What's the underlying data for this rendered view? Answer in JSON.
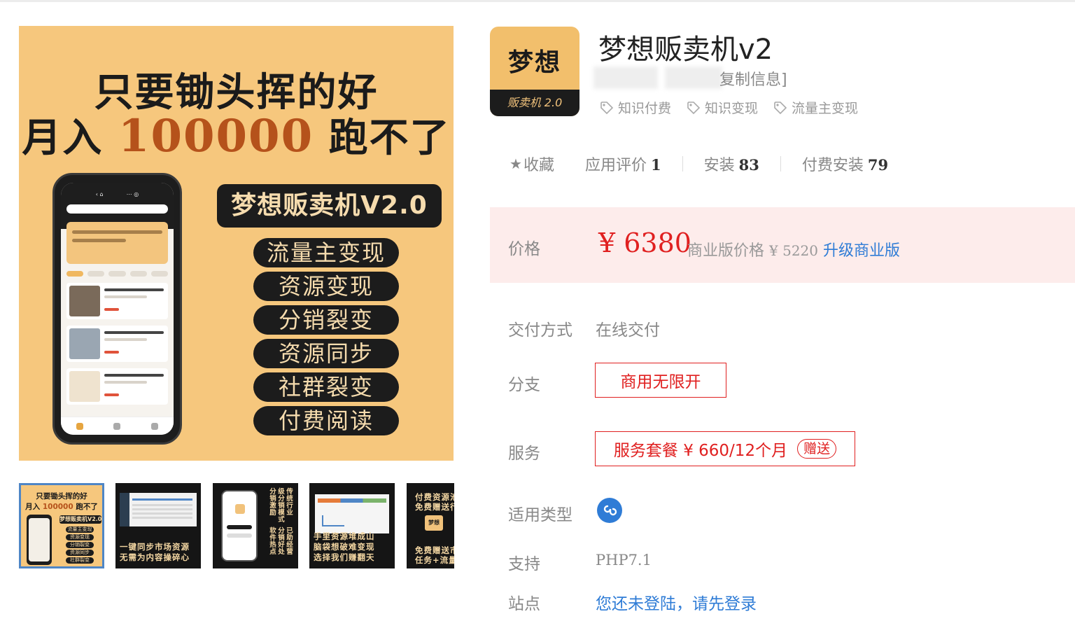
{
  "hero": {
    "line1": "只要锄头挥的好",
    "line2_pre": "月入",
    "line2_num": "100000",
    "line2_post": "跑不了",
    "product_name": "梦想贩卖机V2.0",
    "features": [
      "流量主变现",
      "资源变现",
      "分销裂变",
      "资源同步",
      "社群裂变",
      "付费阅读"
    ]
  },
  "thumbnails": {
    "t1_line1": "只要锄头挥的好",
    "t1_line2_pre": "月入",
    "t1_line2_num": "100000",
    "t1_line2_post": "跑不了",
    "t1_name": "梦想贩卖机V2.0",
    "t2_caption_1": "一键同步市场资源",
    "t2_caption_2": "无需为内容操碎心",
    "t3_cols": [
      "传统行业",
      "级分销模式",
      "分销激励",
      "已助经营",
      "分销好处",
      "软件热点"
    ],
    "t4_caption_1": "手里资源堆成山",
    "t4_caption_2": "脑袋想破难变现",
    "t4_caption_3": "选择我们赚翻天",
    "t5_top_1": "付费资源池",
    "t5_top_2": "免费赠送行",
    "t5_logo": "梦想",
    "t5_bottom_1": "免费赠送市",
    "t5_bottom_2": "任务+流量"
  },
  "app": {
    "logo_top": "梦想",
    "logo_band": "贩卖机 2.0",
    "title": "梦想贩卖机v2",
    "copy_info": "复制信息]",
    "tags": [
      "知识付费",
      "知识变现",
      "流量主变现"
    ],
    "favorite_label": "收藏",
    "stats": [
      {
        "label": "应用评价",
        "value": "1"
      },
      {
        "label": "安装",
        "value": "83"
      },
      {
        "label": "付费安装",
        "value": "79"
      }
    ]
  },
  "price": {
    "label": "价格",
    "amount": "¥ 6380",
    "commercial_label": "商业版价格",
    "commercial_amount": "¥ 5220",
    "upgrade_link": "升级商业版"
  },
  "details": {
    "delivery_label": "交付方式",
    "delivery_value": "在线交付",
    "branch_label": "分支",
    "branch_option": "商用无限开",
    "service_label": "服务",
    "service_option": "服务套餐 ¥ 660/12个月",
    "service_gift": "赠送",
    "type_label": "适用类型",
    "type_icon": "mini-program-icon",
    "support_label": "支持",
    "support_value": "PHP7.1",
    "site_label": "站点",
    "site_value": "您还未登陆，请先登录"
  },
  "colors": {
    "accent_red": "#e02020",
    "link_blue": "#2f7cd6",
    "hero_bg": "#f6c77d",
    "price_bg": "#fdeceb"
  }
}
